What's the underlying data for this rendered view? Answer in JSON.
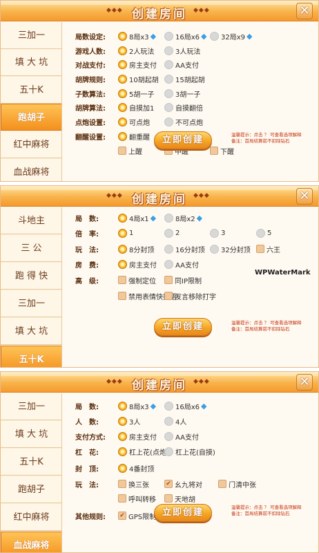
{
  "watermark": "WPWaterMark",
  "panels": [
    {
      "title": "创建房间",
      "deco": "◆◆◆",
      "create_button": "立即创建",
      "hint_line1": "温馨提示：点击 ？ 可查看选项解释",
      "hint_line2": "备注：首局结算前不扣除钻石",
      "sidebar": [
        "三加一",
        "填 大 坑",
        "五十K",
        "跑胡子",
        "红中麻将",
        "血战麻将"
      ],
      "active_index": 3,
      "rows": [
        {
          "label": "局数设定:",
          "options": [
            {
              "text": "8局x3",
              "on": true,
              "gem": true
            },
            {
              "text": "16局x6",
              "on": false,
              "gem": true
            },
            {
              "text": "32局x9",
              "on": false,
              "gem": true
            }
          ]
        },
        {
          "label": "游戏人数:",
          "options": [
            {
              "text": "2人玩法",
              "on": true
            },
            {
              "text": "3人玩法",
              "on": false
            }
          ]
        },
        {
          "label": "对战支付:",
          "options": [
            {
              "text": "房主支付",
              "on": true
            },
            {
              "text": "AA支付",
              "on": false
            }
          ]
        },
        {
          "label": "胡牌规则:",
          "options": [
            {
              "text": "10胡起胡",
              "on": true
            },
            {
              "text": "15胡起胡",
              "on": false
            }
          ]
        },
        {
          "label": "子数算法:",
          "options": [
            {
              "text": "5胡一子",
              "on": true
            },
            {
              "text": "3胡一子",
              "on": false
            }
          ]
        },
        {
          "label": "胡牌算法:",
          "options": [
            {
              "text": "自摸加1",
              "on": true
            },
            {
              "text": "自摸翻倍",
              "on": false
            }
          ]
        },
        {
          "label": "点炮设置:",
          "options": [
            {
              "text": "可点炮",
              "on": true
            },
            {
              "text": "不可点炮",
              "on": false
            }
          ]
        },
        {
          "label": "翻醒设置:",
          "options": [
            {
              "text": "翻重醒",
              "on": true
            },
            {
              "text": "不翻重醒",
              "on": false
            }
          ]
        },
        {
          "label": "",
          "options": [
            {
              "text": "上醒",
              "check": true
            },
            {
              "text": "中醒",
              "check": true
            },
            {
              "text": "下醒",
              "check": true
            }
          ]
        }
      ]
    },
    {
      "title": "创建房间",
      "deco": "◆◆◆",
      "create_button": "立即创建",
      "hint_line1": "温馨提示：点击 ？ 可查看选项解释",
      "hint_line2": "备注：首局结算前不扣除钻石",
      "sidebar": [
        "斗地主",
        "三 公",
        "跑 得 快",
        "三加一",
        "填 大 坑",
        "五十K"
      ],
      "active_index": 5,
      "rows": [
        {
          "label": "局　数:",
          "options": [
            {
              "text": "4局x1",
              "on": true,
              "gem": true
            },
            {
              "text": "8局x2",
              "on": false,
              "gem": true
            }
          ]
        },
        {
          "label": "倍　率:",
          "options": [
            {
              "text": "1",
              "on": true
            },
            {
              "text": "2",
              "on": false
            },
            {
              "text": "3",
              "on": false
            },
            {
              "text": "5",
              "on": false
            }
          ]
        },
        {
          "label": "玩　法:",
          "options": [
            {
              "text": "8分封顶",
              "on": true
            },
            {
              "text": "16分封顶",
              "on": false
            },
            {
              "text": "32分封顶",
              "on": false
            },
            {
              "text": "六王",
              "check": true
            }
          ]
        },
        {
          "label": "房　费:",
          "options": [
            {
              "text": "房主支付",
              "on": true
            },
            {
              "text": "AA支付",
              "on": false
            }
          ]
        },
        {
          "label": "高　级:",
          "options": [
            {
              "text": "强制定位",
              "check": true
            },
            {
              "text": "同IP限制",
              "check": true
            }
          ]
        },
        {
          "label": "",
          "options": [
            {
              "text": "禁用表情快捷语",
              "check": true
            },
            {
              "text": "发言移除打字",
              "check": true
            }
          ]
        }
      ]
    },
    {
      "title": "创建房间",
      "deco": "◆◆◆",
      "create_button": "立即创建",
      "hint_line1": "温馨提示：点击 ？ 可查看选项解释",
      "hint_line2": "备注：首局结算前不扣除钻石",
      "sidebar": [
        "三加一",
        "填 大 坑",
        "五十K",
        "跑胡子",
        "红中麻将",
        "血战麻将"
      ],
      "active_index": 5,
      "rows": [
        {
          "label": "局　数:",
          "options": [
            {
              "text": "8局x3",
              "on": true,
              "gem": true
            },
            {
              "text": "16局x6",
              "on": false,
              "gem": true
            }
          ]
        },
        {
          "label": "人　数:",
          "options": [
            {
              "text": "3人",
              "on": true
            },
            {
              "text": "4人",
              "on": false
            }
          ]
        },
        {
          "label": "支付方式:",
          "options": [
            {
              "text": "房主支付",
              "on": true
            },
            {
              "text": "AA支付",
              "on": false
            }
          ]
        },
        {
          "label": "杠　花:",
          "options": [
            {
              "text": "杠上花(点炮)",
              "on": true
            },
            {
              "text": "杠上花(自摸)",
              "on": false
            }
          ]
        },
        {
          "label": "封　顶:",
          "options": [
            {
              "text": "4番封顶",
              "on": true
            }
          ]
        },
        {
          "label": "玩　法:",
          "options": [
            {
              "text": "换三张",
              "check": true
            },
            {
              "text": "幺九将对",
              "check": true,
              "checked": true
            },
            {
              "text": "门清中张",
              "check": true
            }
          ]
        },
        {
          "label": "",
          "options": [
            {
              "text": "呼叫转移",
              "check": true
            },
            {
              "text": "天地胡",
              "check": true
            }
          ]
        },
        {
          "label": "其他规则:",
          "options": [
            {
              "text": "GPS限制",
              "check": true,
              "checked": true
            }
          ]
        }
      ]
    }
  ]
}
